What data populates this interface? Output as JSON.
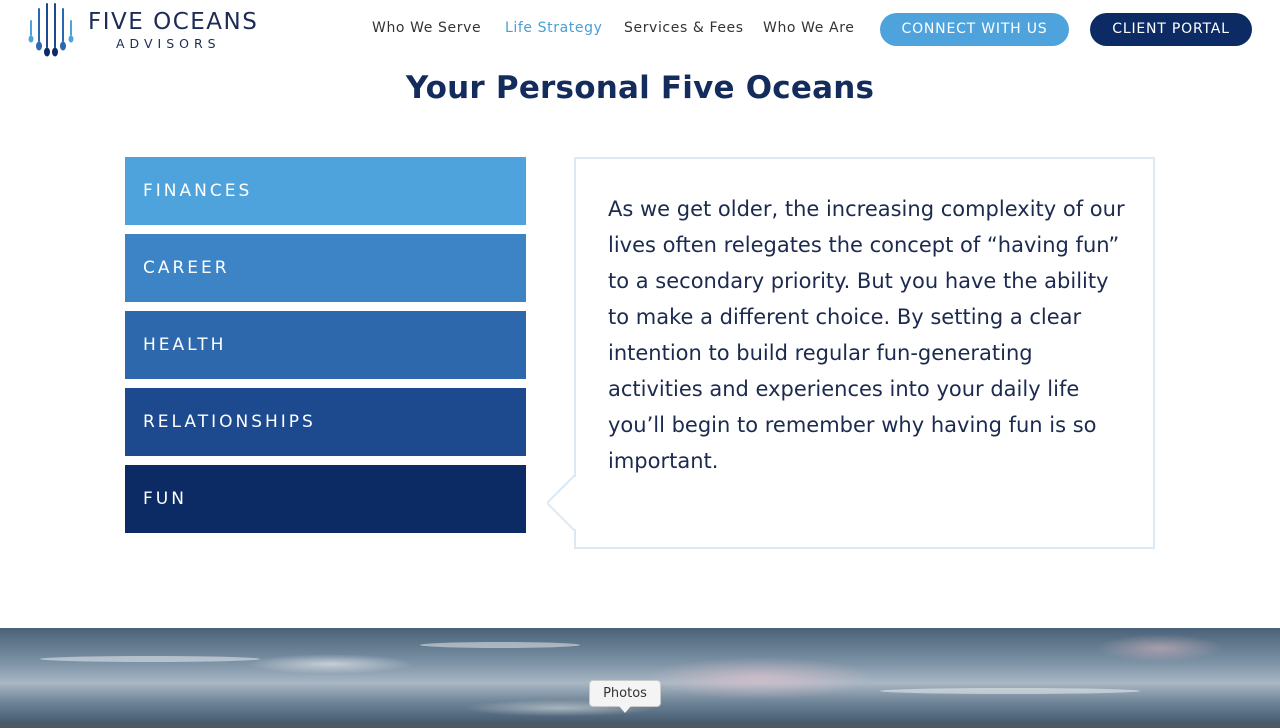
{
  "brand": {
    "name": "FIVE OCEANS",
    "sub": "ADVISORS",
    "icon": "five-drops-logo"
  },
  "nav": {
    "items": [
      {
        "label": "Who We Serve",
        "active": false
      },
      {
        "label": "Life Strategy",
        "active": true
      },
      {
        "label": "Services & Fees",
        "active": false
      },
      {
        "label": "Who We Are",
        "active": false
      }
    ],
    "connect_label": "CONNECT WITH US",
    "portal_label": "CLIENT PORTAL"
  },
  "section": {
    "title": "Your Personal Five Oceans",
    "tabs": [
      {
        "label": "FINANCES",
        "color": "#4ea3dd"
      },
      {
        "label": "CAREER",
        "color": "#3d84c6"
      },
      {
        "label": "HEALTH",
        "color": "#2e68ac"
      },
      {
        "label": "RELATIONSHIPS",
        "color": "#1d4a8f"
      },
      {
        "label": "FUN",
        "color": "#0c2a63"
      }
    ],
    "selected_tab": "FUN",
    "body": "As we get older, the increasing complexity of our lives often relegates the concept of “having fun” to a secondary priority. But you have the ability to make a different choice. By setting a clear intention to build regular fun-generating activities and experiences into your daily life you’ll begin to remember why having fun is so important."
  },
  "tooltip": {
    "label": "Photos"
  },
  "colors": {
    "navy": "#0c2a63",
    "accent": "#4ea3dd",
    "title": "#142c5c",
    "panel_border": "#dbe9f4"
  }
}
